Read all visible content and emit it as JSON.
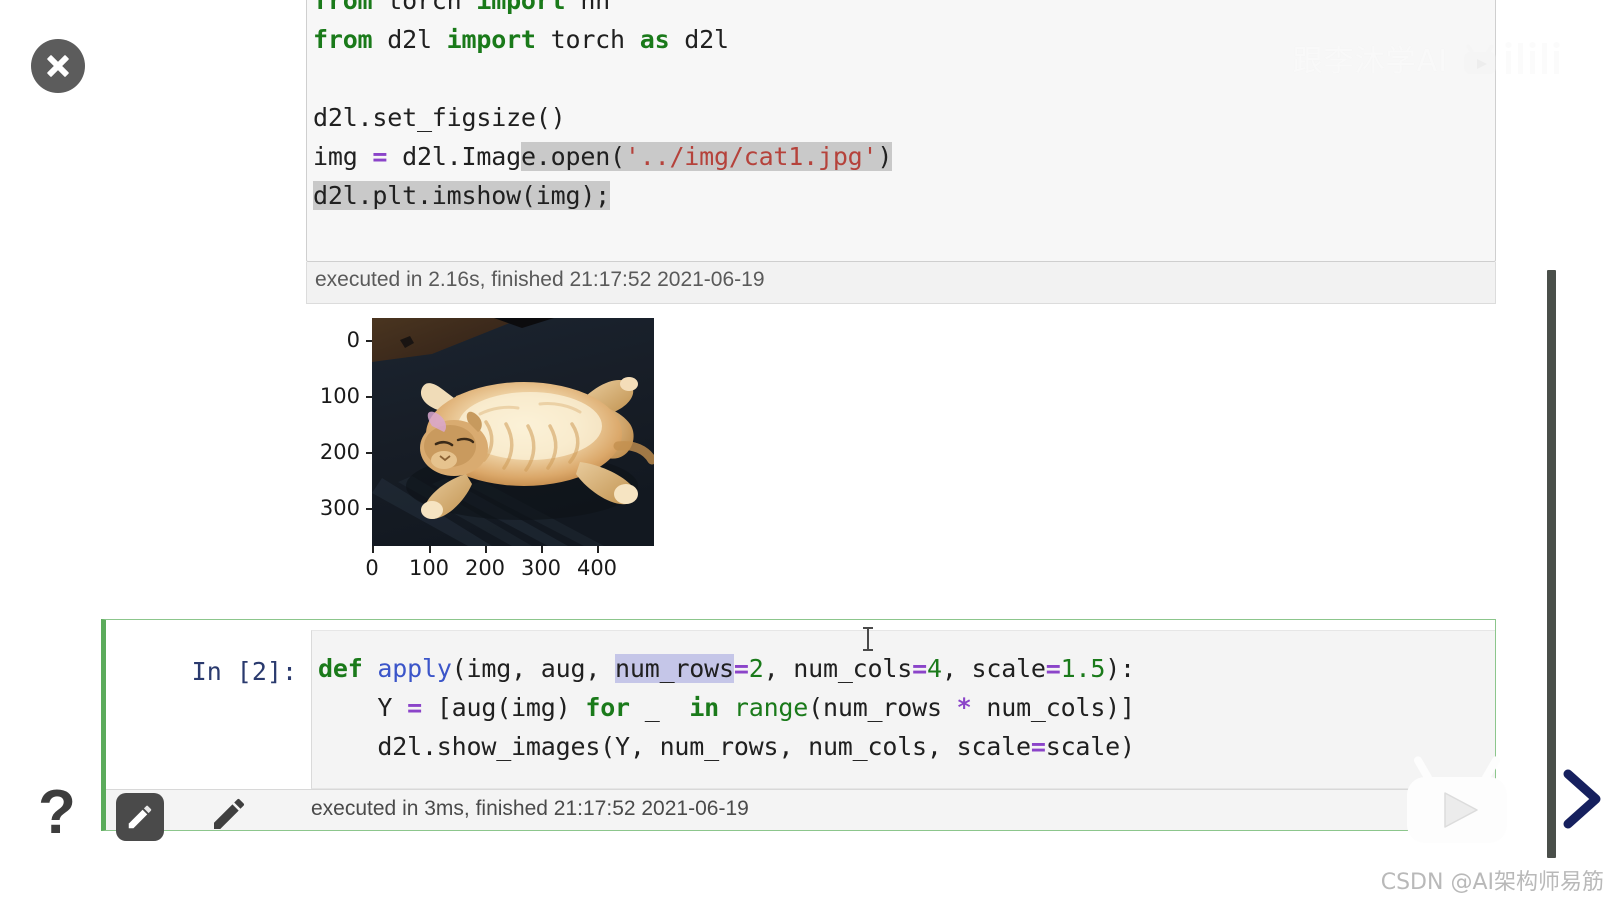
{
  "window": {
    "close_label": "×",
    "help_label": "?"
  },
  "watermarks": {
    "bilibili_text": "跟李沐学AI",
    "bilibili_brand": "bilibili",
    "csdn": "CSDN @AI架构师易筋"
  },
  "colors": {
    "selected_cell_border": "#8cc68c",
    "selected_cell_accent": "#5bab5b",
    "keyword_green": "#1a7a1a",
    "string_red": "#b5423b",
    "operator_purple": "#8b44c9",
    "function_blue": "#3b55c9",
    "prompt_navy": "#2a3a6e",
    "selection_grey": "#c9c9c9",
    "word_match_lavender": "#c5c6e8",
    "scrollbar": "#4a4f4a",
    "close_button_bg": "#5c5c5c"
  },
  "cell1": {
    "code_lines": [
      "from torch import nn",
      "from d2l import torch as d2l",
      "",
      "d2l.set_figsize()",
      "img = d2l.Image.open('../img/cat1.jpg')",
      "d2l.plt.imshow(img);"
    ],
    "line1": {
      "kw_from": "from",
      "mod": " torch ",
      "kw_import": "import",
      "tail": " nn"
    },
    "line2": {
      "kw_from": "from",
      "mod": " d2l ",
      "kw_import": "import",
      "mid": " torch ",
      "kw_as": "as",
      "tail": " d2l"
    },
    "line4": "d2l.set_figsize()",
    "line5": {
      "pre": "img ",
      "eq": "=",
      "mid": " d2l.Imag",
      "sel_mid": "e.open(",
      "str": "'../img/cat1.jpg'",
      "close": ")"
    },
    "line6": "d2l.plt.imshow(img);",
    "exec_status": "executed in 2.16s, finished 21:17:52 2021-06-19"
  },
  "chart_data": {
    "type": "image",
    "title": "",
    "xlabel": "",
    "ylabel": "",
    "xticks": [
      0,
      100,
      200,
      300,
      400
    ],
    "yticks": [
      0,
      100,
      200,
      300
    ],
    "xlim": [
      0,
      450
    ],
    "ylim": [
      360,
      0
    ],
    "description": "matplotlib imshow of cat1.jpg — ginger cat lying on dark floor",
    "grid": false,
    "legend": "none"
  },
  "cell2": {
    "prompt": "In [2]:",
    "code_lines": [
      "def apply(img, aug, num_rows=2, num_cols=4, scale=1.5):",
      "    Y = [aug(img) for _ in range(num_rows * num_cols)]",
      "    d2l.show_images(Y, num_rows, num_cols, scale=scale)"
    ],
    "l1": {
      "kw_def": "def",
      "fname": " apply",
      "args_a": "(img, aug, ",
      "hl": "num_rows",
      "eq1": "=",
      "n1": "2",
      "args_b": ", num_cols",
      "eq2": "=",
      "n2": "4",
      "args_c": ", scale",
      "eq3": "=",
      "n3": "1.5",
      "tail": "):"
    },
    "l2": {
      "indent": "    Y ",
      "eq": "=",
      "a": " [aug(img) ",
      "kw_for": "for",
      "b": " _  ",
      "kw_in": "in",
      "c": " ",
      "fn_range": "range",
      "d": "(num_rows ",
      "star": "*",
      "e": " num_cols)]"
    },
    "l3": {
      "a": "    d2l.show_images(Y, num_rows, num_cols, scale",
      "eq": "=",
      "b": "scale)"
    },
    "exec_status": "executed in 3ms, finished 21:17:52 2021-06-19"
  }
}
